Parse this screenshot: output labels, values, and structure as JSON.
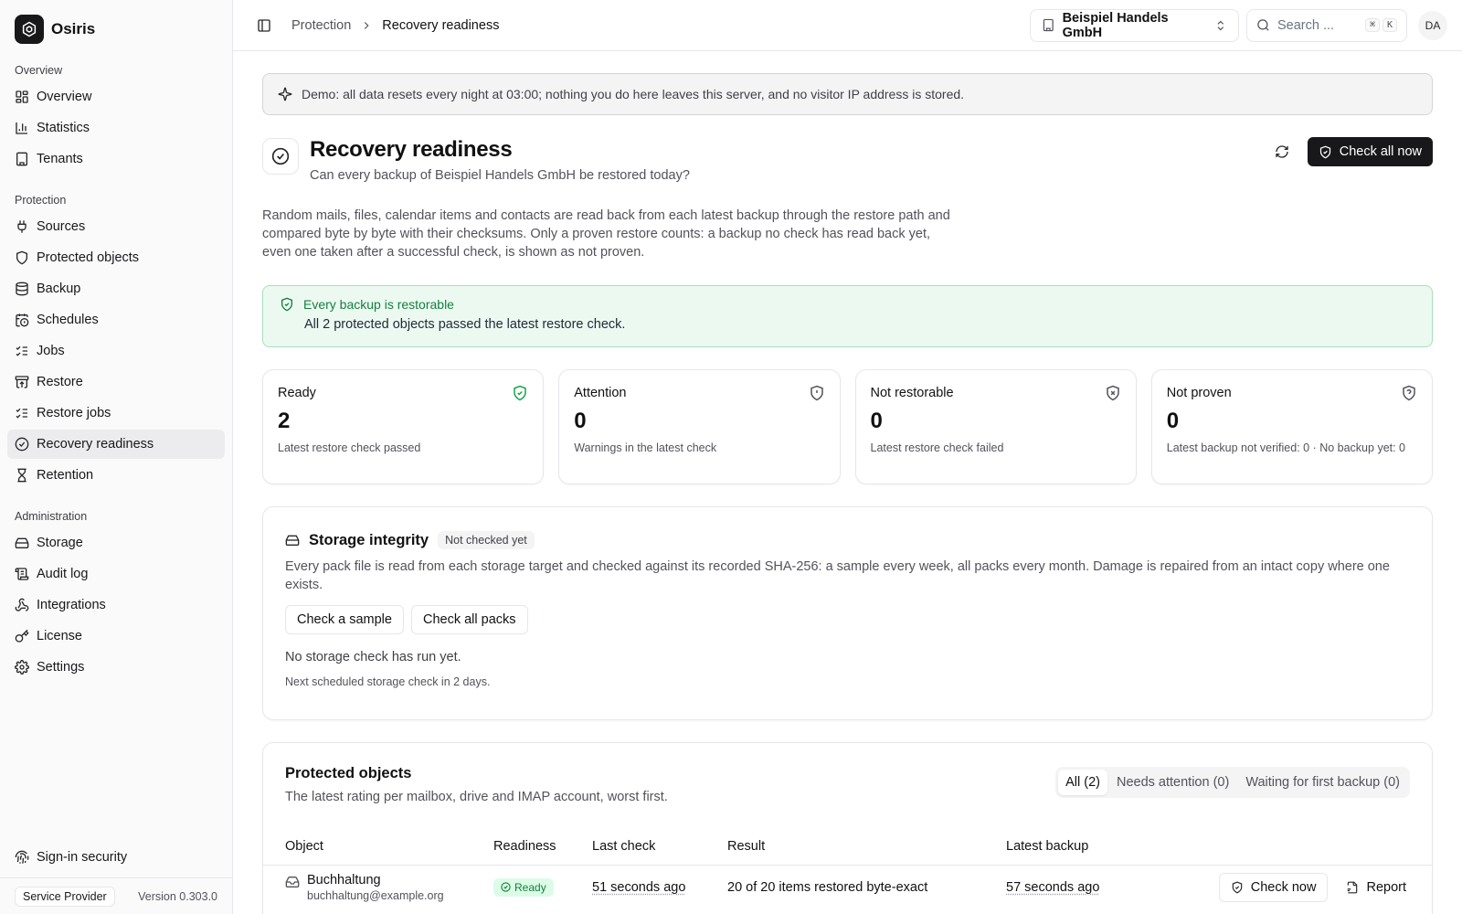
{
  "app": {
    "name": "Osiris"
  },
  "sidebar": {
    "groups": [
      {
        "label": "Overview",
        "items": [
          {
            "label": "Overview",
            "icon": "dashboard-icon"
          },
          {
            "label": "Statistics",
            "icon": "bar-chart-icon"
          },
          {
            "label": "Tenants",
            "icon": "building-icon"
          }
        ]
      },
      {
        "label": "Protection",
        "items": [
          {
            "label": "Sources",
            "icon": "plug-icon"
          },
          {
            "label": "Protected objects",
            "icon": "shield-icon"
          },
          {
            "label": "Backup",
            "icon": "database-icon"
          },
          {
            "label": "Schedules",
            "icon": "calendar-clock-icon"
          },
          {
            "label": "Jobs",
            "icon": "list-checks-icon"
          },
          {
            "label": "Restore",
            "icon": "archive-restore-icon"
          },
          {
            "label": "Restore jobs",
            "icon": "list-checks-icon"
          },
          {
            "label": "Recovery readiness",
            "icon": "circle-check-icon"
          },
          {
            "label": "Retention",
            "icon": "hourglass-icon"
          }
        ]
      },
      {
        "label": "Administration",
        "items": [
          {
            "label": "Storage",
            "icon": "hard-drive-icon"
          },
          {
            "label": "Audit log",
            "icon": "scroll-icon"
          },
          {
            "label": "Integrations",
            "icon": "webhook-icon"
          },
          {
            "label": "License",
            "icon": "key-icon"
          },
          {
            "label": "Settings",
            "icon": "gear-icon"
          }
        ]
      }
    ],
    "sign_in_security": "Sign-in security",
    "role_badge": "Service Provider",
    "version": "Version 0.303.0"
  },
  "topbar": {
    "breadcrumb": {
      "parent": "Protection",
      "current": "Recovery readiness"
    },
    "tenant": "Beispiel Handels GmbH",
    "search_placeholder": "Search ...",
    "kbd_cmd": "⌘",
    "kbd_k": "K",
    "avatar": "DA"
  },
  "demo_banner": "Demo: all data resets every night at 03:00; nothing you do here leaves this server, and no visitor IP address is stored.",
  "page": {
    "title": "Recovery readiness",
    "subtitle": "Can every backup of Beispiel Handels GmbH be restored today?",
    "check_all_label": "Check all now",
    "intro": "Random mails, files, calendar items and contacts are read back from each latest backup through the restore path and compared byte by byte with their checksums. Only a proven restore counts: a backup no check has read back yet, even one taken after a successful check, is shown as not proven."
  },
  "status_banner": {
    "title": "Every backup is restorable",
    "text": "All 2 protected objects passed the latest restore check."
  },
  "stats": [
    {
      "label": "Ready",
      "value": "2",
      "desc": "Latest restore check passed",
      "icon": "shield-check-icon"
    },
    {
      "label": "Attention",
      "value": "0",
      "desc": "Warnings in the latest check",
      "icon": "shield-alert-icon"
    },
    {
      "label": "Not restorable",
      "value": "0",
      "desc": "Latest restore check failed",
      "icon": "shield-x-icon"
    },
    {
      "label": "Not proven",
      "value": "0",
      "desc": "Latest backup not verified: 0 · No backup yet: 0",
      "icon": "shield-question-icon"
    }
  ],
  "storage": {
    "title": "Storage integrity",
    "status_chip": "Not checked yet",
    "desc": "Every pack file is read from each storage target and checked against its recorded SHA-256: a sample every week, all packs every month. Damage is repaired from an intact copy where one exists.",
    "btn_sample": "Check a sample",
    "btn_all": "Check all packs",
    "empty": "No storage check has run yet.",
    "next": "Next scheduled storage check in 2 days."
  },
  "objects": {
    "title": "Protected objects",
    "subtitle": "The latest rating per mailbox, drive and IMAP account, worst first.",
    "tabs": [
      "All (2)",
      "Needs attention (0)",
      "Waiting for first backup (0)"
    ],
    "columns": [
      "Object",
      "Readiness",
      "Last check",
      "Result",
      "Latest backup",
      ""
    ],
    "rows": [
      {
        "name": "Buchhaltung",
        "email": "buchhaltung@example.org",
        "readiness": "Ready",
        "last_check": "51 seconds ago",
        "result": "20 of 20 items restored byte-exact",
        "latest_backup": "57 seconds ago",
        "check_now": "Check now",
        "report": "Report"
      }
    ]
  },
  "colors": {
    "accent": "#18181b",
    "success": "#15803d",
    "success_bg": "#ecf9f1"
  }
}
